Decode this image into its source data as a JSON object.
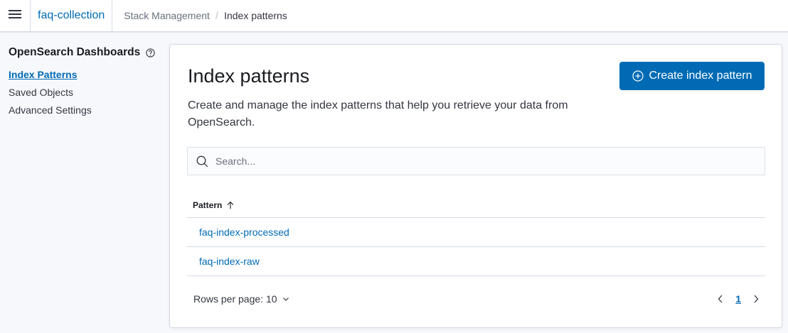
{
  "header": {
    "space_name": "faq-collection",
    "breadcrumbs": [
      "Stack Management",
      "Index patterns"
    ]
  },
  "sidebar": {
    "title": "OpenSearch Dashboards",
    "items": [
      {
        "label": "Index Patterns",
        "active": true
      },
      {
        "label": "Saved Objects",
        "active": false
      },
      {
        "label": "Advanced Settings",
        "active": false
      }
    ]
  },
  "main": {
    "title": "Index patterns",
    "description": "Create and manage the index patterns that help you retrieve your data from OpenSearch.",
    "create_button_label": "Create index pattern",
    "search": {
      "placeholder": "Search...",
      "value": ""
    },
    "table": {
      "columns": [
        {
          "label": "Pattern",
          "sort": "ascending"
        }
      ],
      "rows": [
        {
          "pattern": "faq-index-processed"
        },
        {
          "pattern": "faq-index-raw"
        }
      ]
    },
    "pagination": {
      "rows_per_page_label": "Rows per page: 10",
      "current_page": "1"
    }
  },
  "icons": {
    "menu": "hamburger-icon",
    "help": "question-circle-icon",
    "create": "plus-circle-icon",
    "search": "search-icon",
    "sort": "arrow-up-icon",
    "dropdown": "chevron-down-icon",
    "prev": "chevron-left-icon",
    "next": "chevron-right-icon"
  },
  "colors": {
    "accent": "#006bb4",
    "text": "#343741",
    "background": "#f7f8fc"
  }
}
